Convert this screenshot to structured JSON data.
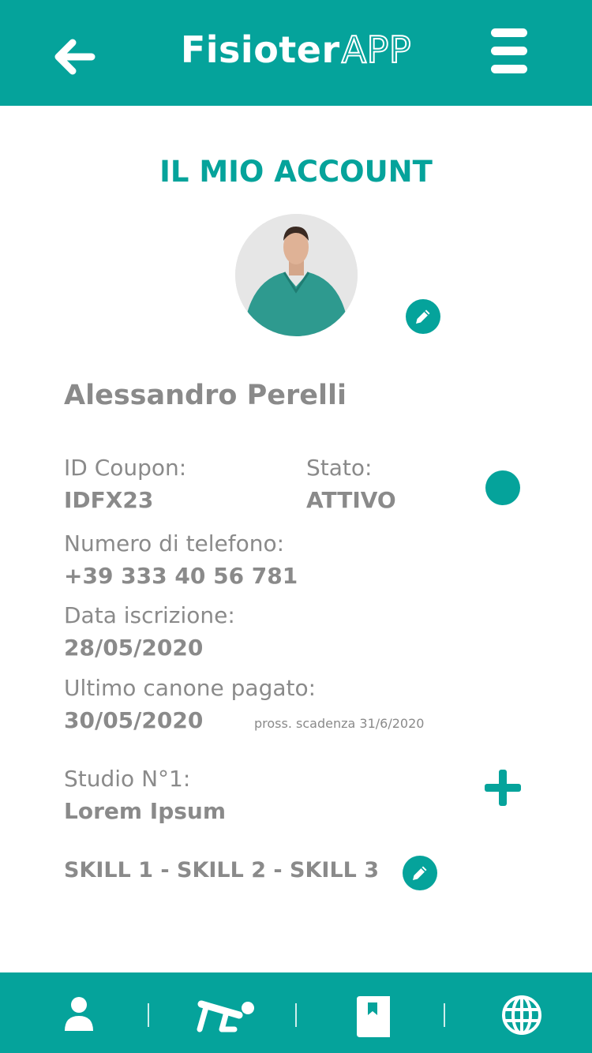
{
  "header": {
    "brand_main": "Fisioter",
    "brand_suffix": "APP",
    "back_icon": "arrow-left-icon",
    "menu_icon": "hamburger-menu-icon"
  },
  "page": {
    "title": "IL MIO ACCOUNT"
  },
  "profile": {
    "name": "Alessandro Perelli",
    "coupon_label": "ID Coupon:",
    "coupon_value": "IDFX23",
    "status_label": "Stato:",
    "status_value": "ATTIVO",
    "phone_label": "Numero di telefono:",
    "phone_value": "+39 333 40 56 781",
    "signup_label": "Data iscrizione:",
    "signup_value": "28/05/2020",
    "fee_label": "Ultimo canone pagato:",
    "fee_value": "30/05/2020",
    "next_due": "pross. scadenza 31/6/2020",
    "studio_label": "Studio N°1:",
    "studio_value": "Lorem Ipsum",
    "skills": "SKILL  1 - SKILL 2 - SKILL 3"
  },
  "nav": {
    "items": [
      "profile-icon",
      "exercise-icon",
      "book-icon",
      "globe-icon"
    ]
  },
  "colors": {
    "accent": "#05a39b",
    "text": "#8a8a8a",
    "background": "#ffffff"
  }
}
